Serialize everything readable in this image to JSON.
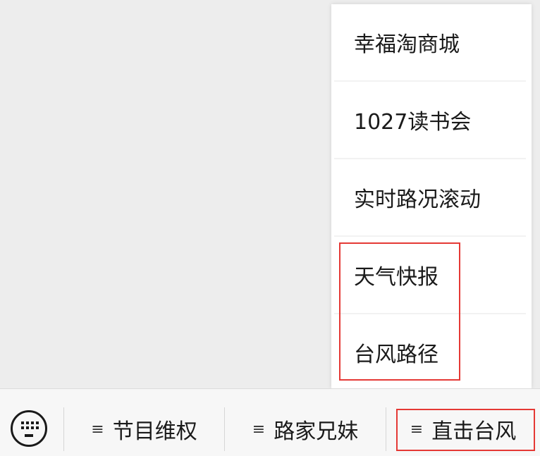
{
  "popup_menu": {
    "items": [
      {
        "label": "幸福淘商城"
      },
      {
        "label": "1027读书会"
      },
      {
        "label": "实时路况滚动"
      },
      {
        "label": "天气快报"
      },
      {
        "label": "台风路径"
      }
    ]
  },
  "bottom_bar": {
    "keyboard_icon": "keyboard-icon",
    "menu_icon_glyph": "≡",
    "tabs": [
      {
        "label": "节目维权"
      },
      {
        "label": "路家兄妹"
      },
      {
        "label": "直击台风"
      }
    ]
  },
  "colors": {
    "highlight": "#e53935",
    "background": "#ededed",
    "menu_bg": "#ffffff"
  }
}
